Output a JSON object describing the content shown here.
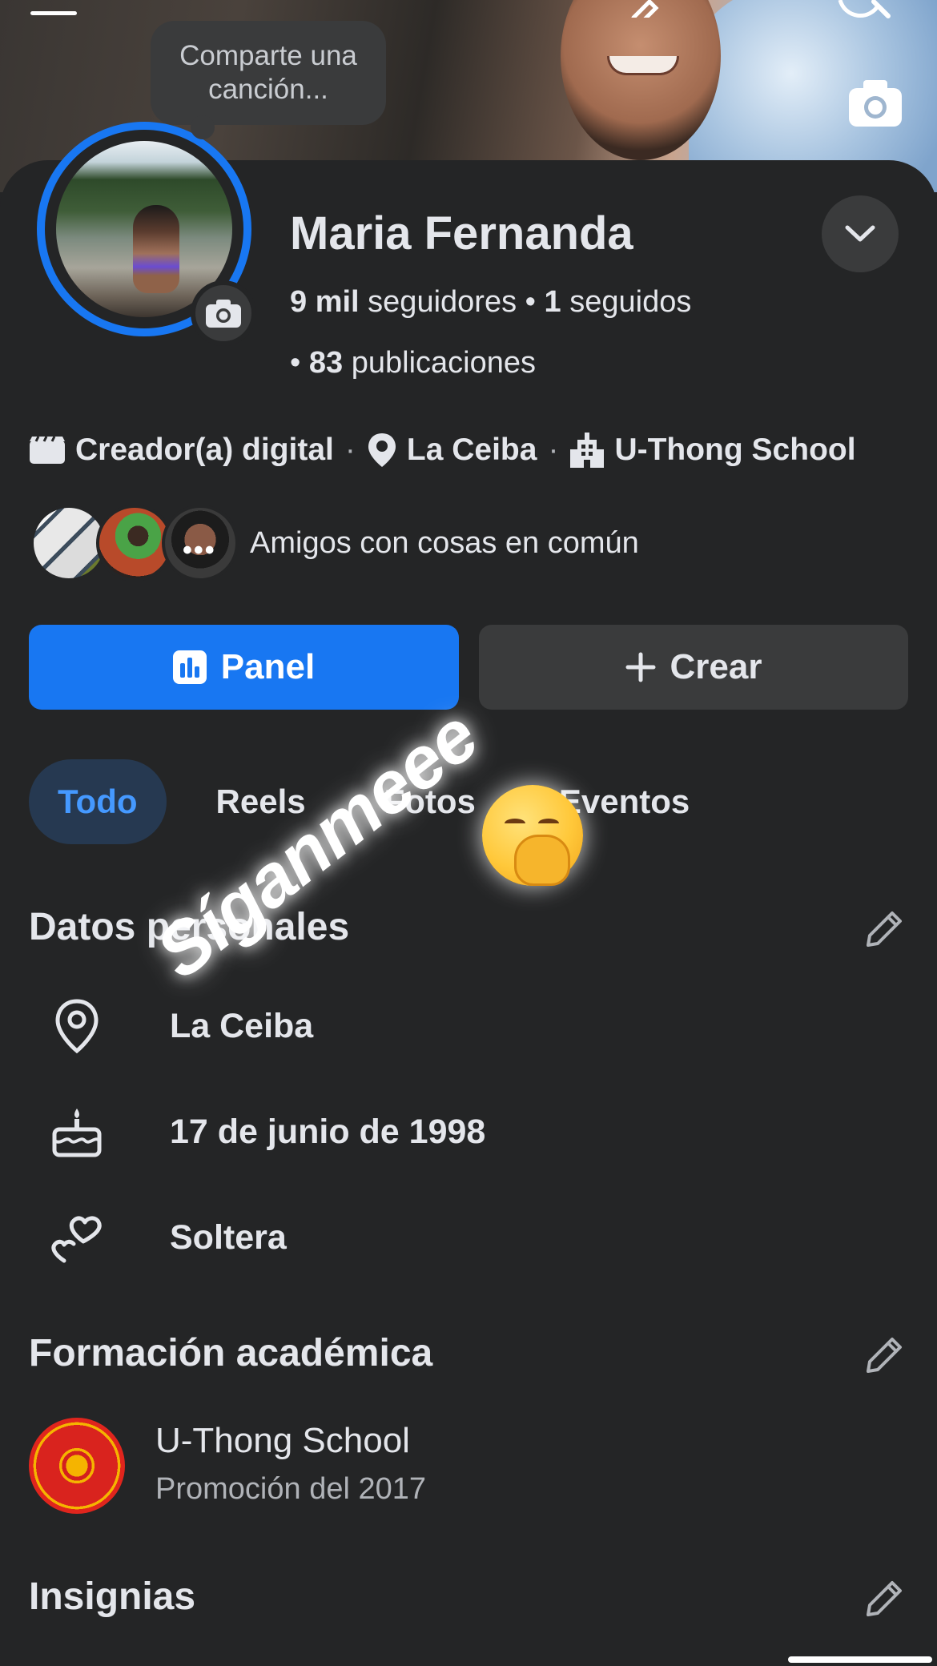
{
  "cover": {
    "song_prompt": "Comparte una canción..."
  },
  "profile": {
    "name": "Maria Fernanda",
    "followers_count": "9 mil",
    "followers_label": "seguidores",
    "following_count": "1",
    "following_label": "seguidos",
    "posts_count": "83",
    "posts_label": "publicaciones"
  },
  "meta": {
    "category": "Creador(a) digital",
    "location": "La Ceiba",
    "school": "U-Thong School"
  },
  "friends": {
    "label": "Amigos con cosas en común"
  },
  "actions": {
    "panel_label": "Panel",
    "create_label": "Crear"
  },
  "tabs": [
    {
      "label": "Todo",
      "active": true
    },
    {
      "label": "Reels",
      "active": false
    },
    {
      "label": "Fotos",
      "active": false
    },
    {
      "label": "Eventos",
      "active": false
    }
  ],
  "personal": {
    "title": "Datos personales",
    "items": [
      {
        "icon": "location-pin-icon",
        "text": "La Ceiba"
      },
      {
        "icon": "birthday-cake-icon",
        "text": "17 de junio de 1998"
      },
      {
        "icon": "hearts-icon",
        "text": "Soltera"
      }
    ]
  },
  "education": {
    "title": "Formación académica",
    "school": "U-Thong School",
    "detail": "Promoción del 2017"
  },
  "badges": {
    "title": "Insignias"
  },
  "overlay": {
    "sticker_text": "Síganmeee"
  },
  "colors": {
    "background": "#242526",
    "accent": "#1877f2",
    "secondary_button": "#3a3b3c",
    "active_tab_bg": "#263951",
    "active_tab_text": "#4599ff"
  }
}
